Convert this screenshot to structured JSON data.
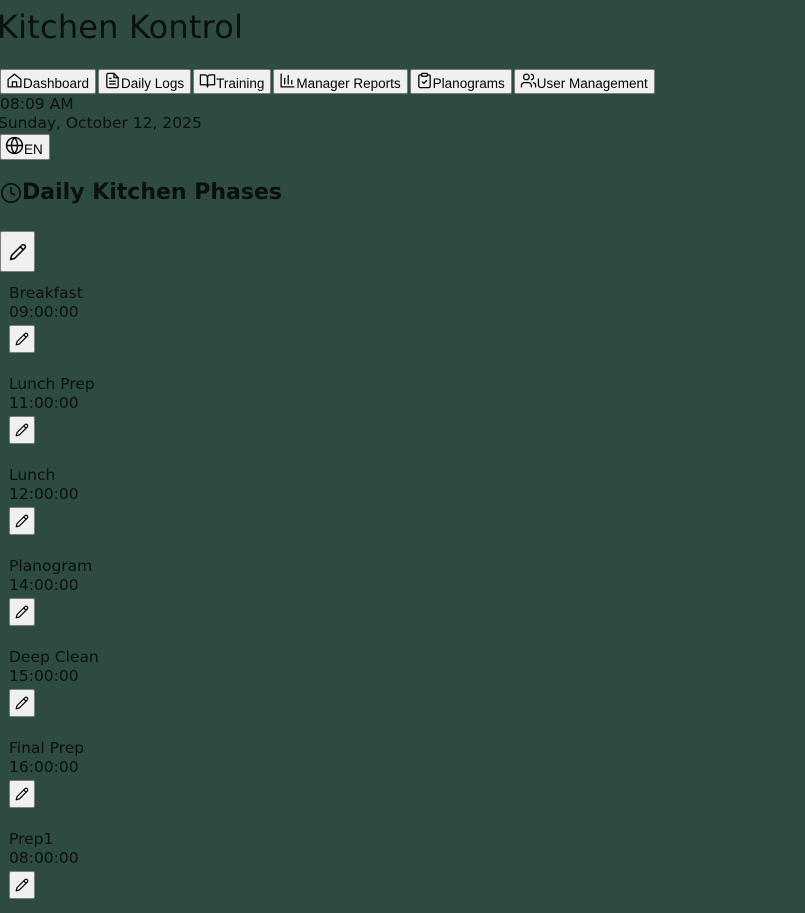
{
  "app": {
    "title": "Kitchen Kontrol"
  },
  "nav": {
    "items": [
      {
        "label": "Dashboard",
        "icon": "home-icon"
      },
      {
        "label": "Daily Logs",
        "icon": "file-text-icon"
      },
      {
        "label": "Training",
        "icon": "book-open-icon"
      },
      {
        "label": "Manager Reports",
        "icon": "bar-chart-icon"
      },
      {
        "label": "Planograms",
        "icon": "clipboard-check-icon"
      },
      {
        "label": "User Management",
        "icon": "users-icon"
      }
    ]
  },
  "header": {
    "time": "08:09 AM",
    "date": "Sunday, October 12, 2025",
    "language": "EN"
  },
  "phases_section": {
    "title": "Daily Kitchen Phases",
    "items": [
      {
        "name": "Breakfast",
        "time": "09:00:00"
      },
      {
        "name": "Lunch Prep",
        "time": "11:00:00"
      },
      {
        "name": "Lunch",
        "time": "12:00:00"
      },
      {
        "name": "Planogram",
        "time": "14:00:00"
      },
      {
        "name": "Deep Clean",
        "time": "15:00:00"
      },
      {
        "name": "Final Prep",
        "time": "16:00:00"
      },
      {
        "name": "Prep1",
        "time": "08:00:00"
      }
    ]
  }
}
